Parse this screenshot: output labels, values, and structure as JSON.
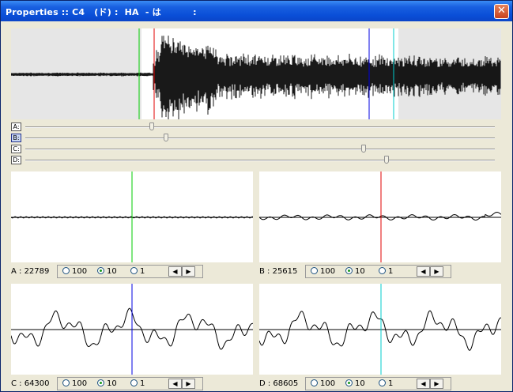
{
  "window": {
    "title": "Properties :: C4   (ド) :  HA  - は          :",
    "close_glyph": "✕"
  },
  "sliders": [
    {
      "label": "A:",
      "level": 0.27,
      "active": false
    },
    {
      "label": "B:",
      "level": 0.3,
      "active": true
    },
    {
      "label": "C:",
      "level": 0.72,
      "active": false
    },
    {
      "label": "D:",
      "level": 0.77,
      "active": false
    }
  ],
  "markers": {
    "A": "#00CC00",
    "B": "#E00000",
    "C": "#0000E0",
    "D": "#00CCCC"
  },
  "channels": [
    {
      "key": "A",
      "label": "A : 22789",
      "selected": "10"
    },
    {
      "key": "B",
      "label": "B : 25615",
      "selected": "10"
    },
    {
      "key": "C",
      "label": "C : 64300",
      "selected": "10"
    },
    {
      "key": "D",
      "label": "D : 68605",
      "selected": "10"
    }
  ],
  "zoom_options": [
    "100",
    "10",
    "1"
  ],
  "nav": {
    "prev_glyph": "◀",
    "next_glyph": "▶"
  },
  "colors": {
    "titlebar": "#0A4FD8",
    "panel_bg": "#FFFFFF",
    "inactive_region": "#E6E6E6"
  }
}
